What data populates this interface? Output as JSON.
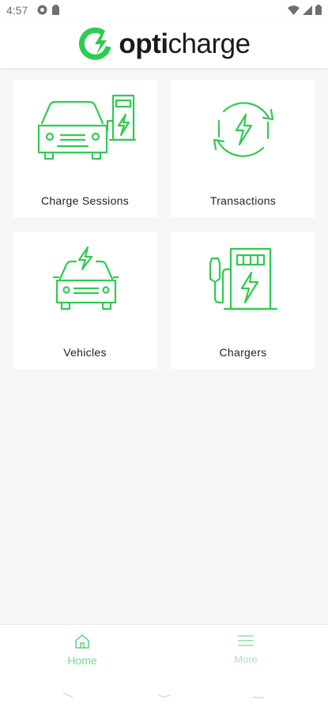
{
  "status_bar": {
    "time": "4:57",
    "left_icons": [
      "circle-app-icon",
      "clipboard-icon"
    ],
    "right_icons": [
      "wifi-icon",
      "signal-icon",
      "battery-icon"
    ]
  },
  "header": {
    "logo_prefix": "opti",
    "logo_suffix": "charge",
    "brand_color": "#2ecc50"
  },
  "tiles": [
    {
      "label": "Charge Sessions",
      "icon": "car-charging-icon"
    },
    {
      "label": "Transactions",
      "icon": "recycle-bolt-icon"
    },
    {
      "label": "Vehicles",
      "icon": "electric-car-icon"
    },
    {
      "label": "Chargers",
      "icon": "charging-station-icon"
    }
  ],
  "bottom_nav": {
    "home_label": "Home",
    "more_label": "More",
    "active": "Home"
  }
}
